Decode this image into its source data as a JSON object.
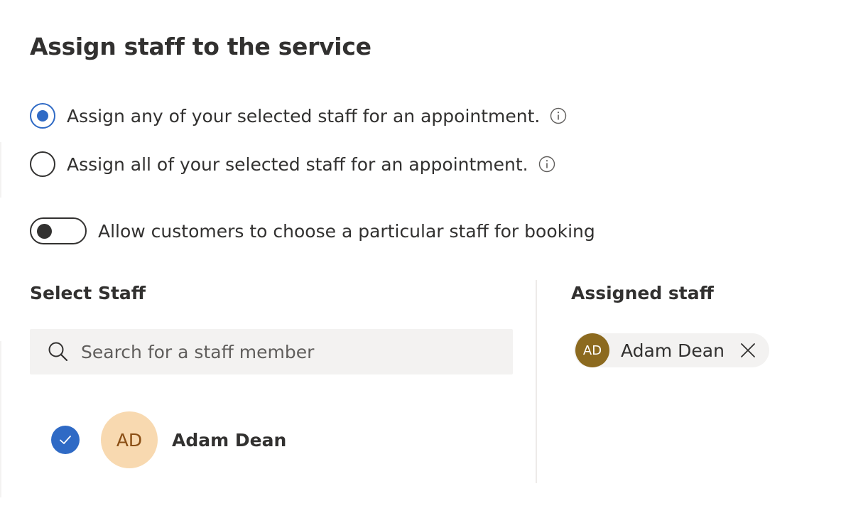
{
  "page": {
    "title": "Assign staff to the service"
  },
  "assignment_options": [
    {
      "label": "Assign any of your selected staff for an appointment.",
      "selected": true,
      "icon": "info-icon"
    },
    {
      "label": "Assign all of your selected staff for an appointment.",
      "selected": false,
      "icon": "info-icon"
    }
  ],
  "toggle": {
    "label": "Allow customers to choose a particular staff for booking",
    "on": false
  },
  "select_staff": {
    "label": "Select Staff",
    "search_placeholder": "Search for a staff member",
    "search_value": "",
    "staff": [
      {
        "initials": "AD",
        "name": "Adam Dean",
        "checked": true
      }
    ]
  },
  "assigned_staff": {
    "label": "Assigned staff",
    "chips": [
      {
        "initials": "AD",
        "name": "Adam Dean",
        "remove_icon": "close-icon"
      }
    ]
  },
  "colors": {
    "accent": "#2f6ac5",
    "text": "#323130",
    "avatar_large_bg": "#f8d9b0",
    "avatar_large_text": "#8a4e14",
    "avatar_small_bg": "#8c6a1f",
    "chip_bg": "#f3f2f1"
  }
}
